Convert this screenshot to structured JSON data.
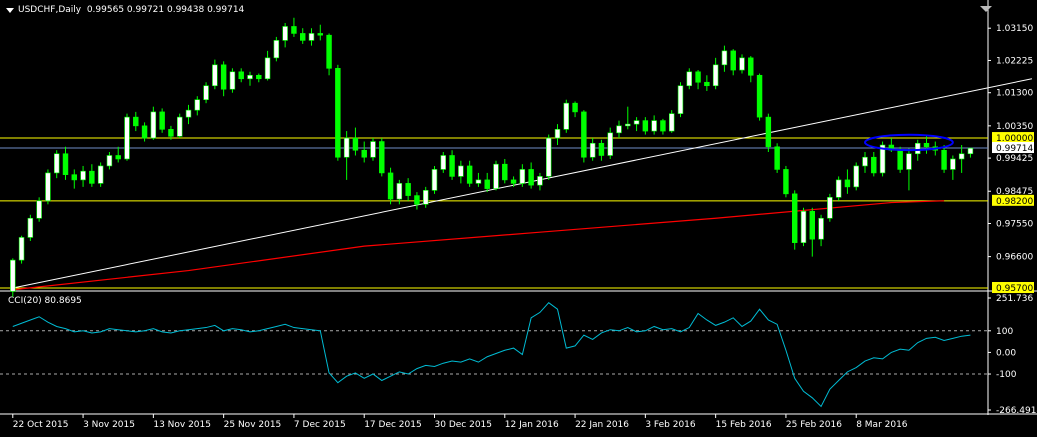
{
  "header": {
    "symbol": "USDCHF,Daily",
    "ohlc": "0.99565 0.99721 0.99438 0.99714",
    "cci_label": "CCI(20) 80.8695"
  },
  "colors": {
    "background": "#000000",
    "bull_candle": "#ffffff",
    "bear_candle": "#00ff00",
    "wick": "#00ff00",
    "ma": "#ff0000",
    "trendline": "#ffffff",
    "level_line": "#ffff00",
    "bid_line": "#708ec7",
    "cci_line": "#00bcd4",
    "ellipse": "#0000ff",
    "axis_text": "#ffffff"
  },
  "chart_data": [
    {
      "type": "candlestick",
      "symbol": "USDCHF",
      "timeframe": "Daily",
      "ylim": [
        0.957,
        1.035
      ],
      "y_ticks": [
        "1.03150",
        "1.02225",
        "1.01300",
        "1.00350",
        "0.99425",
        "0.98475",
        "0.97550",
        "0.96600"
      ],
      "x_ticks": [
        "22 Oct 2015",
        "3 Nov 2015",
        "13 Nov 2015",
        "25 Nov 2015",
        "7 Dec 2015",
        "17 Dec 2015",
        "30 Dec 2015",
        "12 Jan 2016",
        "22 Jan 2016",
        "3 Feb 2016",
        "15 Feb 2016",
        "25 Feb 2016",
        "8 Mar 2016"
      ],
      "price_labels": [
        {
          "text": "1.00000",
          "value": 1.0,
          "style": "yellow"
        },
        {
          "text": "0.99714",
          "value": 0.99714,
          "style": "white"
        },
        {
          "text": "0.98200",
          "value": 0.982,
          "style": "yellow"
        },
        {
          "text": "0.95700",
          "value": 0.957,
          "style": "yellow"
        }
      ],
      "levels": [
        1.0,
        0.982,
        0.957
      ],
      "trendline": {
        "from": [
          0,
          0.957
        ],
        "to": [
          116,
          1.017
        ]
      },
      "ellipse": {
        "center": [
          102,
          0.99875
        ],
        "rx": 5,
        "ry": 0.0022
      },
      "moving_average": [
        [
          0,
          0.9565
        ],
        [
          20,
          0.962
        ],
        [
          40,
          0.969
        ],
        [
          60,
          0.973
        ],
        [
          80,
          0.977
        ],
        [
          100,
          0.9815
        ],
        [
          106,
          0.982
        ]
      ],
      "candles": [
        [
          0.956,
          0.9655,
          0.9545,
          0.965
        ],
        [
          0.965,
          0.972,
          0.964,
          0.9715
        ],
        [
          0.9715,
          0.978,
          0.9705,
          0.977
        ],
        [
          0.977,
          0.983,
          0.976,
          0.982
        ],
        [
          0.982,
          0.991,
          0.981,
          0.99
        ],
        [
          0.99,
          0.9965,
          0.9885,
          0.9955
        ],
        [
          0.9955,
          0.9975,
          0.988,
          0.9895
        ],
        [
          0.9895,
          0.991,
          0.9855,
          0.988
        ],
        [
          0.988,
          0.992,
          0.986,
          0.9905
        ],
        [
          0.9905,
          0.9925,
          0.986,
          0.987
        ],
        [
          0.987,
          0.993,
          0.986,
          0.992
        ],
        [
          0.992,
          0.996,
          0.991,
          0.995
        ],
        [
          0.995,
          0.9975,
          0.993,
          0.994
        ],
        [
          0.994,
          1.007,
          0.9935,
          1.006
        ],
        [
          1.006,
          1.0075,
          1.002,
          1.0035
        ],
        [
          1.0035,
          1.0045,
          0.999,
          1.0
        ],
        [
          1.0,
          1.009,
          0.9995,
          1.0075
        ],
        [
          1.0075,
          1.0085,
          1.0015,
          1.0025
        ],
        [
          1.0025,
          1.0035,
          0.9995,
          1.0005
        ],
        [
          1.0005,
          1.007,
          1.0,
          1.006
        ],
        [
          1.006,
          1.0095,
          1.004,
          1.008
        ],
        [
          1.008,
          1.012,
          1.0065,
          1.011
        ],
        [
          1.011,
          1.016,
          1.01,
          1.015
        ],
        [
          1.015,
          1.0225,
          1.014,
          1.021
        ],
        [
          1.021,
          1.022,
          1.012,
          1.014
        ],
        [
          1.014,
          1.02,
          1.013,
          1.019
        ],
        [
          1.019,
          1.02,
          1.016,
          1.017
        ],
        [
          1.017,
          1.019,
          1.015,
          1.018
        ],
        [
          1.018,
          1.0185,
          1.016,
          1.017
        ],
        [
          1.017,
          1.025,
          1.0165,
          1.023
        ],
        [
          1.023,
          1.029,
          1.022,
          1.028
        ],
        [
          1.028,
          1.033,
          1.026,
          1.032
        ],
        [
          1.032,
          1.0345,
          1.029,
          1.03
        ],
        [
          1.03,
          1.0315,
          1.027,
          1.028
        ],
        [
          1.028,
          1.0315,
          1.0265,
          1.03
        ],
        [
          1.03,
          1.0325,
          1.028,
          1.0295
        ],
        [
          1.0295,
          1.03,
          1.018,
          1.02
        ],
        [
          1.02,
          1.021,
          0.9935,
          0.9945
        ],
        [
          0.9945,
          1.002,
          0.988,
          1.0
        ],
        [
          1.0,
          1.003,
          0.995,
          0.9965
        ],
        [
          0.9965,
          0.999,
          0.993,
          0.9945
        ],
        [
          0.9945,
          1.0,
          0.9935,
          0.999
        ],
        [
          0.999,
          1.0,
          0.989,
          0.99
        ],
        [
          0.99,
          0.9915,
          0.981,
          0.9825
        ],
        [
          0.9825,
          0.988,
          0.981,
          0.987
        ],
        [
          0.987,
          0.9885,
          0.982,
          0.9835
        ],
        [
          0.9835,
          0.9845,
          0.9795,
          0.981
        ],
        [
          0.981,
          0.986,
          0.98,
          0.985
        ],
        [
          0.985,
          0.992,
          0.984,
          0.991
        ],
        [
          0.991,
          0.996,
          0.99,
          0.995
        ],
        [
          0.995,
          0.9965,
          0.988,
          0.989
        ],
        [
          0.989,
          0.9935,
          0.987,
          0.992
        ],
        [
          0.992,
          0.9935,
          0.986,
          0.987
        ],
        [
          0.987,
          0.99,
          0.986,
          0.988
        ],
        [
          0.988,
          0.99,
          0.9845,
          0.9855
        ],
        [
          0.9855,
          0.9935,
          0.985,
          0.9925
        ],
        [
          0.9925,
          0.994,
          0.987,
          0.988
        ],
        [
          0.988,
          0.989,
          0.986,
          0.987
        ],
        [
          0.987,
          0.9925,
          0.986,
          0.991
        ],
        [
          0.991,
          0.993,
          0.9855,
          0.9865
        ],
        [
          0.9865,
          0.99,
          0.985,
          0.989
        ],
        [
          0.989,
          1.001,
          0.988,
          1.0
        ],
        [
          1.0,
          1.004,
          0.998,
          1.0025
        ],
        [
          1.0025,
          1.011,
          1.0015,
          1.01
        ],
        [
          1.01,
          1.0105,
          1.006,
          1.0075
        ],
        [
          1.0075,
          1.008,
          0.993,
          0.9945
        ],
        [
          0.9945,
          1.0,
          0.9935,
          0.9985
        ],
        [
          0.9985,
          0.9995,
          0.9935,
          0.995
        ],
        [
          0.995,
          1.003,
          0.994,
          1.0015
        ],
        [
          1.0015,
          1.005,
          1.0,
          1.0035
        ],
        [
          1.0035,
          1.009,
          1.0025,
          1.004
        ],
        [
          1.004,
          1.006,
          1.002,
          1.005
        ],
        [
          1.005,
          1.006,
          1.001,
          1.002
        ],
        [
          1.002,
          1.0065,
          1.001,
          1.005
        ],
        [
          1.005,
          1.0055,
          1.001,
          1.002
        ],
        [
          1.002,
          1.008,
          1.0015,
          1.007
        ],
        [
          1.007,
          1.016,
          1.006,
          1.015
        ],
        [
          1.015,
          1.02,
          1.014,
          1.019
        ],
        [
          1.019,
          1.0195,
          1.014,
          1.016
        ],
        [
          1.016,
          1.018,
          1.0135,
          1.015
        ],
        [
          1.015,
          1.023,
          1.014,
          1.021
        ],
        [
          1.021,
          1.0265,
          1.019,
          1.025
        ],
        [
          1.025,
          1.0255,
          1.018,
          1.0195
        ],
        [
          1.0195,
          1.024,
          1.0185,
          1.023
        ],
        [
          1.023,
          1.0235,
          1.016,
          1.018
        ],
        [
          1.018,
          1.0185,
          1.005,
          1.006
        ],
        [
          1.006,
          1.007,
          0.996,
          0.9975
        ],
        [
          0.9975,
          0.9985,
          0.99,
          0.991
        ],
        [
          0.991,
          0.992,
          0.983,
          0.984
        ],
        [
          0.984,
          0.985,
          0.968,
          0.97
        ],
        [
          0.97,
          0.98,
          0.969,
          0.979
        ],
        [
          0.979,
          0.98,
          0.966,
          0.971
        ],
        [
          0.971,
          0.978,
          0.969,
          0.977
        ],
        [
          0.977,
          0.984,
          0.976,
          0.983
        ],
        [
          0.983,
          0.989,
          0.982,
          0.988
        ],
        [
          0.988,
          0.991,
          0.984,
          0.986
        ],
        [
          0.986,
          0.993,
          0.985,
          0.992
        ],
        [
          0.992,
          0.996,
          0.99,
          0.9945
        ],
        [
          0.9945,
          0.996,
          0.989,
          0.99
        ],
        [
          0.99,
          0.999,
          0.989,
          0.998
        ],
        [
          0.998,
          1.0,
          0.996,
          0.9965
        ],
        [
          0.9965,
          0.9975,
          0.99,
          0.991
        ],
        [
          0.991,
          0.997,
          0.985,
          0.9955
        ],
        [
          0.9955,
          0.9995,
          0.9935,
          0.9985
        ],
        [
          0.9985,
          1.0005,
          0.9955,
          0.9975
        ],
        [
          0.9975,
          0.999,
          0.995,
          0.9965
        ],
        [
          0.9965,
          0.998,
          0.99,
          0.991
        ],
        [
          0.991,
          0.995,
          0.988,
          0.994
        ],
        [
          0.994,
          0.998,
          0.99,
          0.9955
        ],
        [
          0.9955,
          0.9972,
          0.9944,
          0.9971
        ]
      ]
    },
    {
      "type": "line",
      "title": "CCI(20) 80.8695",
      "ylim": [
        -266.4914,
        251.736
      ],
      "y_ticks": [
        "251.736",
        "100",
        "0.00",
        "-100",
        "-266.4914"
      ],
      "levels": [
        100,
        -100
      ],
      "values": [
        120,
        135,
        150,
        165,
        140,
        120,
        110,
        95,
        100,
        90,
        95,
        110,
        105,
        100,
        95,
        100,
        110,
        95,
        90,
        100,
        105,
        110,
        115,
        125,
        100,
        110,
        105,
        95,
        100,
        110,
        120,
        130,
        115,
        110,
        105,
        100,
        -95,
        -140,
        -110,
        -95,
        -120,
        -100,
        -130,
        -110,
        -90,
        -100,
        -75,
        -60,
        -65,
        -50,
        -40,
        -45,
        -30,
        -45,
        -20,
        -5,
        10,
        20,
        -10,
        160,
        185,
        230,
        200,
        20,
        30,
        80,
        60,
        90,
        105,
        100,
        115,
        95,
        100,
        120,
        105,
        110,
        95,
        115,
        180,
        150,
        125,
        140,
        160,
        120,
        145,
        200,
        150,
        130,
        10,
        -120,
        -180,
        -210,
        -250,
        -170,
        -130,
        -90,
        -70,
        -40,
        -25,
        -30,
        0,
        15,
        10,
        45,
        65,
        70,
        55,
        65,
        75,
        80
      ]
    }
  ]
}
